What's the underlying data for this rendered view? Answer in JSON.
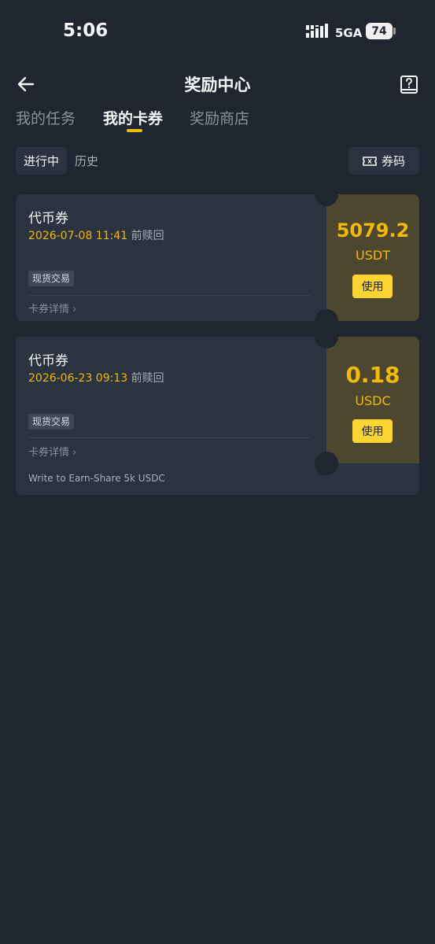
{
  "status_bar": {
    "time": "5:06",
    "network": "5GA",
    "battery": "74"
  },
  "nav": {
    "back_icon": "arrow-left-icon",
    "title": "奖励中心",
    "help_icon": "help-book-icon"
  },
  "tabs": [
    {
      "label": "我的任务",
      "active": false
    },
    {
      "label": "我的卡券",
      "active": true
    },
    {
      "label": "奖励商店",
      "active": false
    }
  ],
  "filters": {
    "active_label": "进行中",
    "history_label": "历史",
    "code_label": "券码",
    "code_icon": "ticket-icon"
  },
  "coupons": [
    {
      "title": "代币券",
      "expiry_date": "2026-07-08 11:41",
      "expiry_suffix": "前赎回",
      "tag": "现货交易",
      "detail": "卡券详情 ›",
      "amount": "5079.2",
      "currency": "USDT",
      "use_label": "使用",
      "note": ""
    },
    {
      "title": "代币券",
      "expiry_date": "2026-06-23 09:13",
      "expiry_suffix": "前赎回",
      "tag": "现货交易",
      "detail": "卡券详情 ›",
      "amount": "0.18",
      "currency": "USDC",
      "use_label": "使用",
      "note": "Write to Earn-Share 5k USDC"
    }
  ],
  "colors": {
    "background": "#1f2630",
    "card": "#2b3341",
    "accent": "#f0b90b",
    "button": "#fcd535"
  }
}
